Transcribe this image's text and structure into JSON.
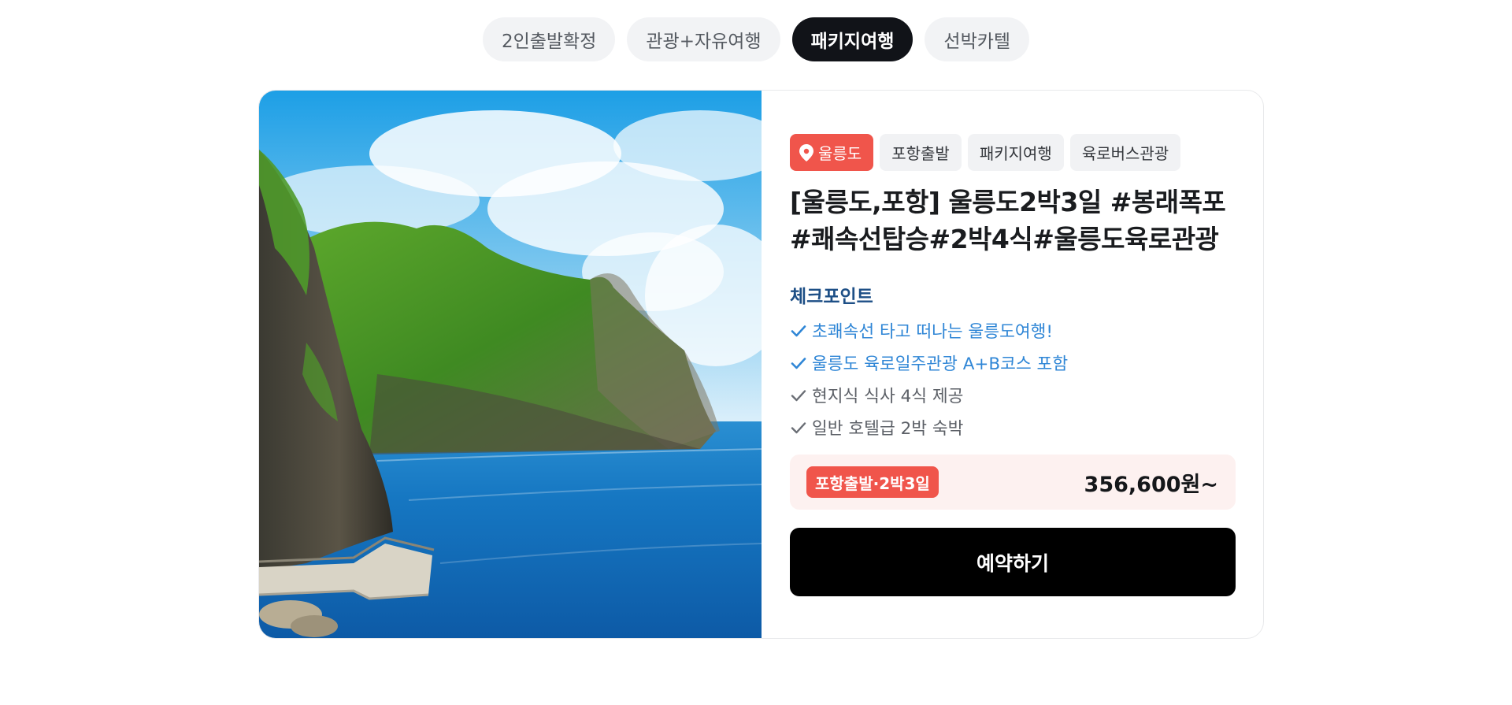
{
  "tabs": [
    {
      "label": "2인출발확정",
      "active": false
    },
    {
      "label": "관광+자유여행",
      "active": false
    },
    {
      "label": "패키지여행",
      "active": true
    },
    {
      "label": "선박카텔",
      "active": false
    }
  ],
  "card": {
    "photo": {
      "alt": "울릉도 해안 절벽과 바다 사진"
    },
    "location_tag": {
      "icon": "location-pin-icon",
      "label": "울릉도"
    },
    "tags": [
      "포항출발",
      "패키지여행",
      "육로버스관광"
    ],
    "title_line1": "[울릉도,포항] 울릉도2박3일 #봉래폭포",
    "title_line2": "#쾌속선탑승#2박4식#울릉도육로관광",
    "checkpoint_heading": "체크포인트",
    "checkpoints": [
      {
        "text": "초쾌속선 타고 떠나는 울릉도여행!",
        "highlight": true
      },
      {
        "text": "울릉도 육로일주관광 A+B코스 포함",
        "highlight": true
      },
      {
        "text": "현지식 식사 4식 제공",
        "highlight": false
      },
      {
        "text": "일반 호텔급 2박 숙박",
        "highlight": false
      }
    ],
    "price_badge": "포항출발·2박3일",
    "price": "356,600원~",
    "book_button": "예약하기"
  },
  "colors": {
    "accent_red": "#f0554b",
    "checkpoint_blue": "#2f86d6",
    "heading_navy": "#1d4f86",
    "active_tab": "#111318",
    "price_box_bg": "#fdf1f0"
  }
}
